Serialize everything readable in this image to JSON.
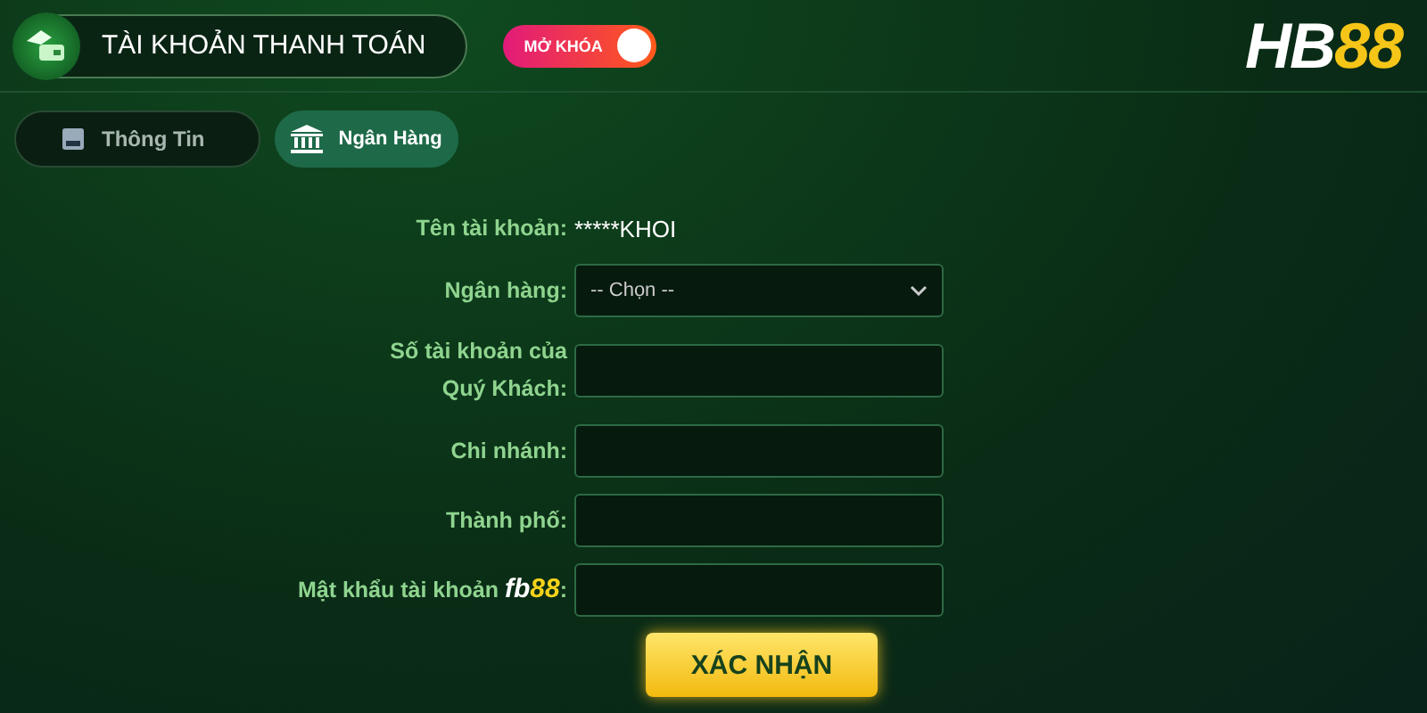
{
  "header": {
    "title": "TÀI KHOẢN THANH TOÁN",
    "toggle": {
      "label": "MỞ KHÓA",
      "on": true
    },
    "logo": {
      "white": "HB",
      "yellow": "88"
    }
  },
  "tabs": [
    {
      "label": "Thông Tin",
      "kind": "card",
      "selected": false
    },
    {
      "label": "Ngân Hàng",
      "kind": "bank",
      "selected": true
    }
  ],
  "form": {
    "rows": [
      {
        "kind": "text",
        "label": "Tên tài khoản:",
        "value": "*****KHOI"
      },
      {
        "kind": "select",
        "label": "Ngân hàng:",
        "value": "-- Chọn --"
      },
      {
        "kind": "input",
        "label": "Số tài khoản của Quý Khách:"
      },
      {
        "kind": "input",
        "label": "Chi nhánh:"
      },
      {
        "kind": "input",
        "label": "Thành phố:"
      },
      {
        "kind": "input",
        "label": "Mật khẩu tài khoản",
        "brand_white": "fb",
        "brand_yellow": "88",
        "suffix": ":"
      }
    ],
    "submit": "XÁC NHẬN"
  }
}
